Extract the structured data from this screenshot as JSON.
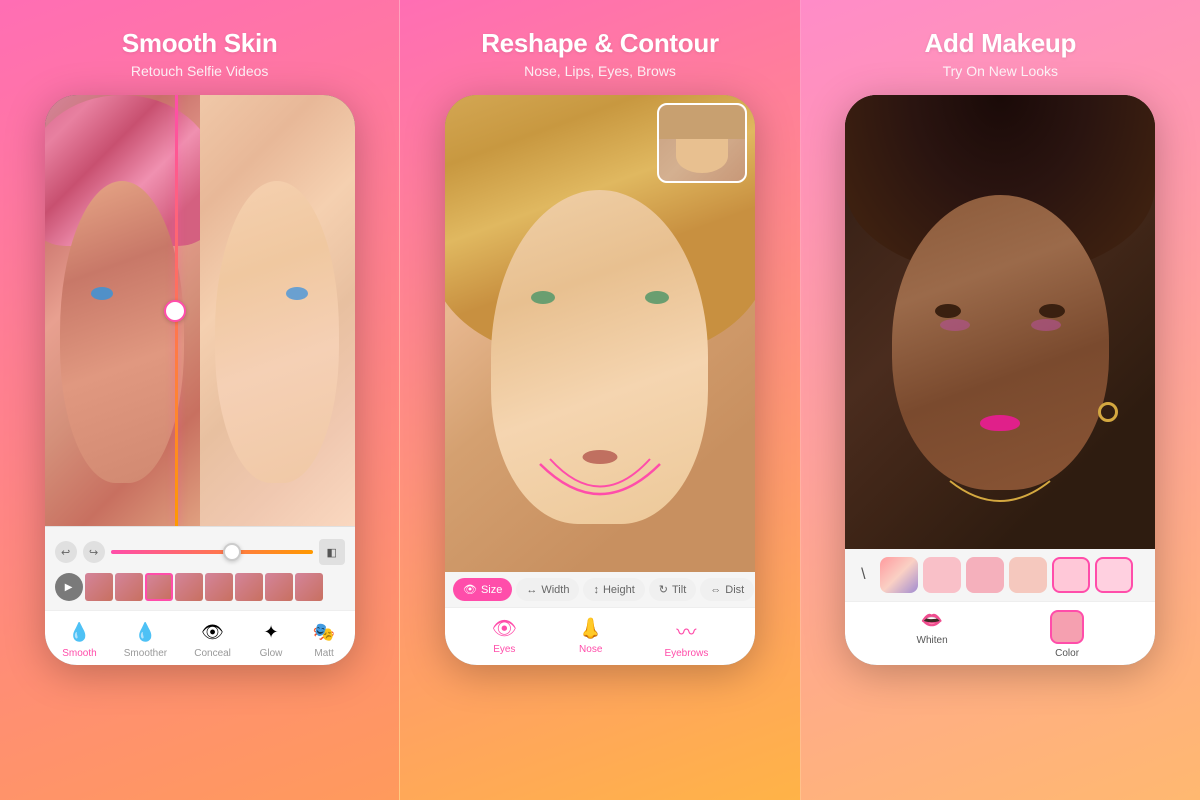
{
  "panels": [
    {
      "id": "smooth-skin",
      "title": "Smooth Skin",
      "subtitle": "Retouch Selfie Videos",
      "tools": [
        {
          "id": "smooth",
          "label": "Smooth",
          "icon": "💧",
          "active": true
        },
        {
          "id": "smoother",
          "label": "Smoother",
          "icon": "💧",
          "active": false
        },
        {
          "id": "conceal",
          "label": "Conceal",
          "icon": "👁",
          "active": false
        },
        {
          "id": "glow",
          "label": "Glow",
          "icon": "✦",
          "active": false
        },
        {
          "id": "matt",
          "label": "Matt",
          "icon": "🎭",
          "active": false
        }
      ],
      "controls": {
        "undo": "↩",
        "redo": "↪",
        "compare": "◧"
      }
    },
    {
      "id": "reshape-contour",
      "title": "Reshape & Contour",
      "subtitle": "Nose, Lips, Eyes, Brows",
      "reshape_tools": [
        {
          "id": "size",
          "label": "Size",
          "active": true
        },
        {
          "id": "width",
          "label": "Width",
          "active": false
        },
        {
          "id": "height",
          "label": "Height",
          "active": false
        },
        {
          "id": "tilt",
          "label": "Tilt",
          "active": false
        },
        {
          "id": "dist",
          "label": "Dist",
          "active": false
        }
      ],
      "face_parts": [
        {
          "id": "eyes",
          "label": "Eyes",
          "active": true
        },
        {
          "id": "nose",
          "label": "Nose",
          "active": false
        },
        {
          "id": "eyebrows",
          "label": "Eyebrows",
          "active": false
        }
      ]
    },
    {
      "id": "add-makeup",
      "title": "Add Makeup",
      "subtitle": "Try On New Looks",
      "makeup_tools": [
        {
          "id": "whiten",
          "label": "Whiten",
          "active": false
        },
        {
          "id": "color",
          "label": "Color",
          "active": true
        }
      ],
      "colors": [
        {
          "id": "gradient",
          "type": "gradient"
        },
        {
          "id": "pink1",
          "type": "light-pink"
        },
        {
          "id": "pink2",
          "type": "med-pink"
        },
        {
          "id": "peach",
          "type": "peach"
        },
        {
          "id": "selected",
          "type": "selected"
        }
      ]
    }
  ]
}
